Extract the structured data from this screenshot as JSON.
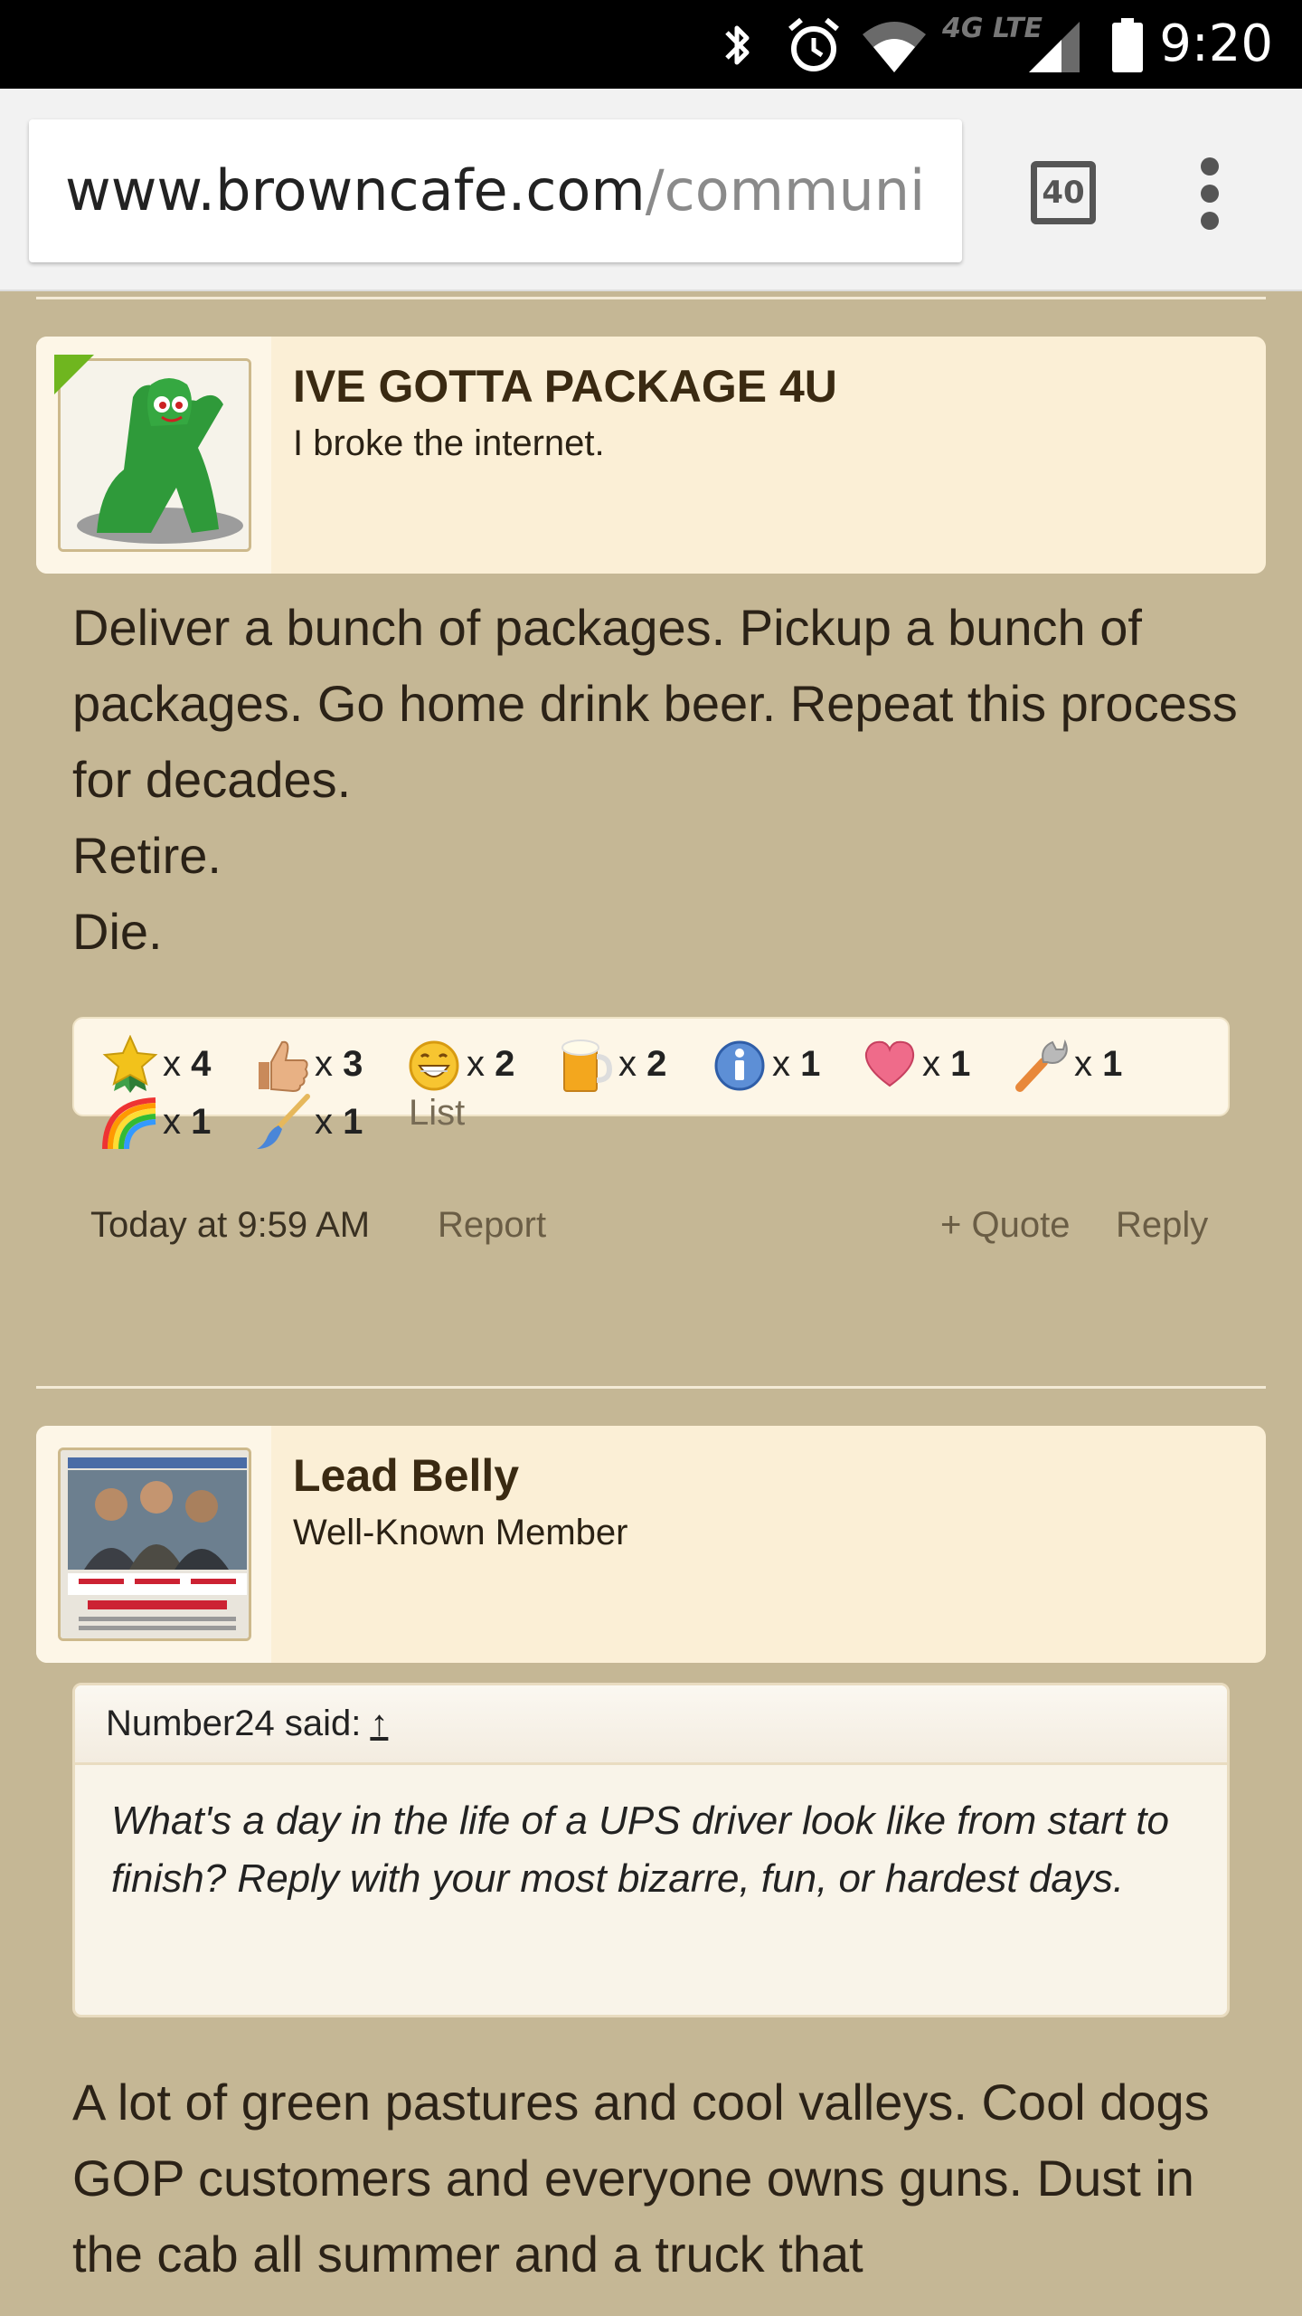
{
  "status_bar": {
    "time": "9:20",
    "network_label": "4G LTE",
    "icons": [
      "bluetooth-icon",
      "alarm-icon",
      "wifi-icon",
      "signal-icon",
      "battery-icon"
    ]
  },
  "browser": {
    "url_host": "www.browncafe.com",
    "url_path": "/communi",
    "tab_count": "40"
  },
  "posts": [
    {
      "username": "IVE GOTTA PACKAGE 4U",
      "user_title": "I broke the internet.",
      "message_lines": [
        "Deliver a bunch of packages. Pickup a bunch of packages. Go home drink beer. Repeat this process for decades.",
        "Retire.",
        "Die."
      ],
      "ratings": [
        {
          "icon": "medal-star-icon",
          "count": "4"
        },
        {
          "icon": "thumbs-up-icon",
          "count": "3"
        },
        {
          "icon": "grin-icon",
          "count": "2"
        },
        {
          "icon": "beer-icon",
          "count": "2"
        },
        {
          "icon": "info-icon",
          "count": "1"
        },
        {
          "icon": "heart-icon",
          "count": "1"
        },
        {
          "icon": "wrench-icon",
          "count": "1"
        },
        {
          "icon": "rainbow-icon",
          "count": "1"
        },
        {
          "icon": "paintbrush-icon",
          "count": "1"
        }
      ],
      "ratings_list_label": "List",
      "timestamp": "Today at 9:59 AM",
      "report_label": "Report",
      "quote_label": "+ Quote",
      "reply_label": "Reply"
    },
    {
      "username": "Lead Belly",
      "user_title": "Well-Known Member",
      "quote": {
        "author": "Number24 said:",
        "arrow": "↑",
        "text": "What's a day in the life of a UPS driver look like from start to finish? Reply with your most bizarre, fun, or hardest days."
      },
      "message_lines": [
        "A lot of green pastures and cool valleys. Cool dogs GOP customers and everyone owns guns. Dust in the cab all summer and a truck that"
      ]
    }
  ],
  "count_prefix": "x ",
  "colors": {
    "page_bg": "#c5b795",
    "card_bg": "#fbefd6",
    "online_flag": "#6fb61f"
  }
}
